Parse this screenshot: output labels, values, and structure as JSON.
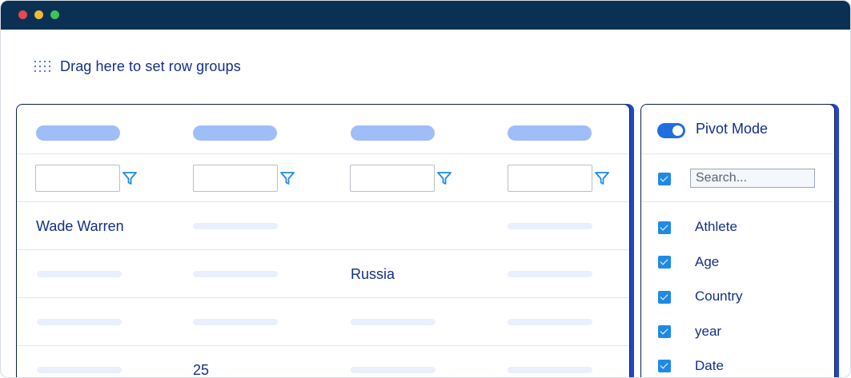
{
  "window": {
    "title_bar_color": "#0a3154",
    "buttons": [
      "close",
      "minimize",
      "maximize"
    ]
  },
  "row_group_zone": {
    "icon": "drag-grid-icon",
    "label": "Drag here to set row groups"
  },
  "grid": {
    "column_count": 4,
    "filter_icon": "filter-icon",
    "rows": [
      {
        "cells": [
          "Wade Warren",
          "",
          "",
          ""
        ]
      },
      {
        "cells": [
          "",
          "",
          "Russia",
          ""
        ]
      },
      {
        "cells": [
          "",
          "",
          "",
          ""
        ]
      },
      {
        "cells": [
          "",
          "25",
          "",
          ""
        ]
      }
    ]
  },
  "side_panel": {
    "pivot_mode": {
      "label": "Pivot Mode",
      "enabled": true
    },
    "search": {
      "placeholder": "Search..."
    },
    "columns": [
      {
        "label": "Athlete",
        "checked": true
      },
      {
        "label": "Age",
        "checked": true
      },
      {
        "label": "Country",
        "checked": true
      },
      {
        "label": "year",
        "checked": true
      },
      {
        "label": "Date",
        "checked": true
      }
    ]
  },
  "colors": {
    "accent": "#1f8ae6",
    "header_placeholder": "#9fbdf7",
    "text": "#12308a"
  }
}
